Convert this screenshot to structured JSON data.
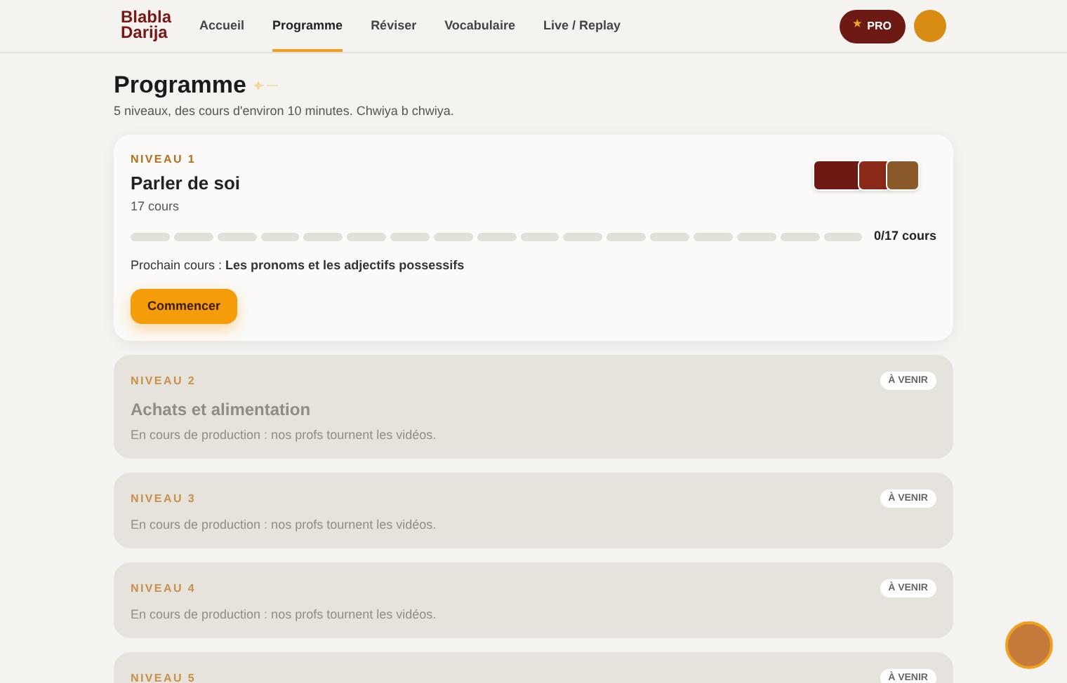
{
  "logo": {
    "line_1": "Blabla",
    "line_2": "Darija"
  },
  "nav": [
    {
      "label": "Accueil",
      "selected": false
    },
    {
      "label": "Programme",
      "selected": true
    },
    {
      "label": "Réviser",
      "selected": false
    },
    {
      "label": "Vocabulaire",
      "selected": false
    },
    {
      "label": "Live / Replay",
      "selected": false
    }
  ],
  "pro_button": {
    "icon": "★",
    "label": "PRO"
  },
  "page": {
    "title": "Programme",
    "subtitle": "5 niveaux, des cours d'environ 10 minutes. Chwiya b chwiya."
  },
  "levels": [
    {
      "kind": "active",
      "label": "NIVEAU 1",
      "title": "Parler de soi",
      "count": "17 cours",
      "level": 0,
      "progress": "0/17 cours",
      "next_label": "Prochain cours :",
      "next_lesson": "Les pronoms et les adjectifs possessifs",
      "button": "Commencer"
    },
    {
      "kind": "upcoming",
      "label": "NIVEAU 2",
      "title": "Achats et alimentation",
      "badge": "À VENIR",
      "note": "En cours de production : nos profs tournent les vidéos."
    },
    {
      "kind": "upcoming",
      "label": "NIVEAU 3",
      "badge": "À VENIR",
      "note": "En cours de production : nos profs tournent les vidéos."
    },
    {
      "kind": "upcoming",
      "label": "NIVEAU 4",
      "badge": "À VENIR",
      "note": "En cours de production : nos profs tournent les vidéos."
    },
    {
      "kind": "upcoming",
      "label": "NIVEAU 5",
      "badge": "À VENIR"
    }
  ]
}
